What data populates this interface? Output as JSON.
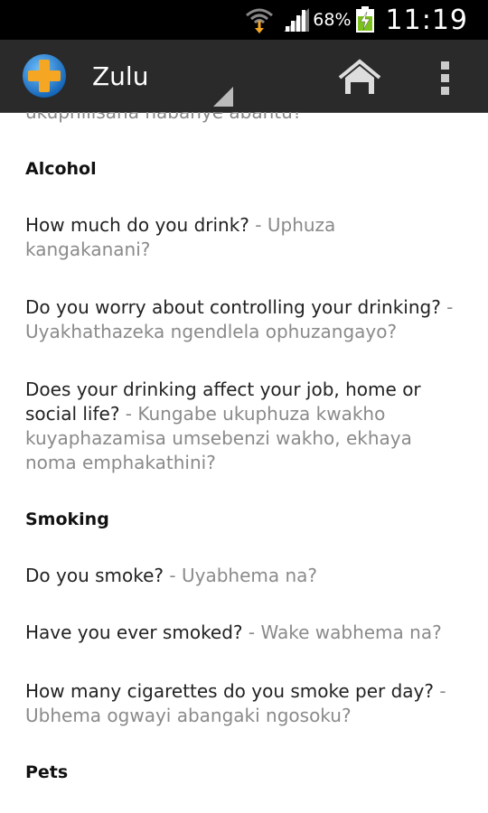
{
  "status_bar": {
    "battery_percent": "68%",
    "time": "11:19"
  },
  "action_bar": {
    "title": "Zulu",
    "logo_icon": "medical-cross-logo",
    "home_icon": "home-icon",
    "overflow_icon": "overflow-menu-icon"
  },
  "content": {
    "cut_off_text": "ukuphilisana nabanye abantu?",
    "sections": [
      {
        "header": "Alcohol",
        "phrases": [
          {
            "english": "How much do you drink?",
            "separator": " - ",
            "zulu": "Uphuza kangakanani?"
          },
          {
            "english": "Do you worry about controlling your drinking?",
            "separator": " - ",
            "zulu": "Uyakhathazeka ngendlela ophuzangayo?"
          },
          {
            "english": "Does your drinking affect your job, home or social life?",
            "separator": " - ",
            "zulu": "Kungabe ukuphuza kwakho kuyaphazamisa umsebenzi wakho, ekhaya noma emphakathini?"
          }
        ]
      },
      {
        "header": "Smoking",
        "phrases": [
          {
            "english": "Do you smoke?",
            "separator": " - ",
            "zulu": "Uyabhema na?"
          },
          {
            "english": "Have you ever smoked?",
            "separator": " - ",
            "zulu": "Wake wabhema na?"
          },
          {
            "english": "How many cigarettes do you smoke per day?",
            "separator": " - ",
            "zulu": "Ubhema ogwayi abangaki ngosoku?"
          }
        ]
      },
      {
        "header": "Pets",
        "phrases": []
      }
    ]
  },
  "colors": {
    "status_bar_bg": "#000000",
    "action_bar_bg": "#2a2a2a",
    "english_text": "#222222",
    "zulu_text": "#8a8a8a",
    "logo_blue": "#1e88d8",
    "logo_orange": "#f5a623"
  }
}
